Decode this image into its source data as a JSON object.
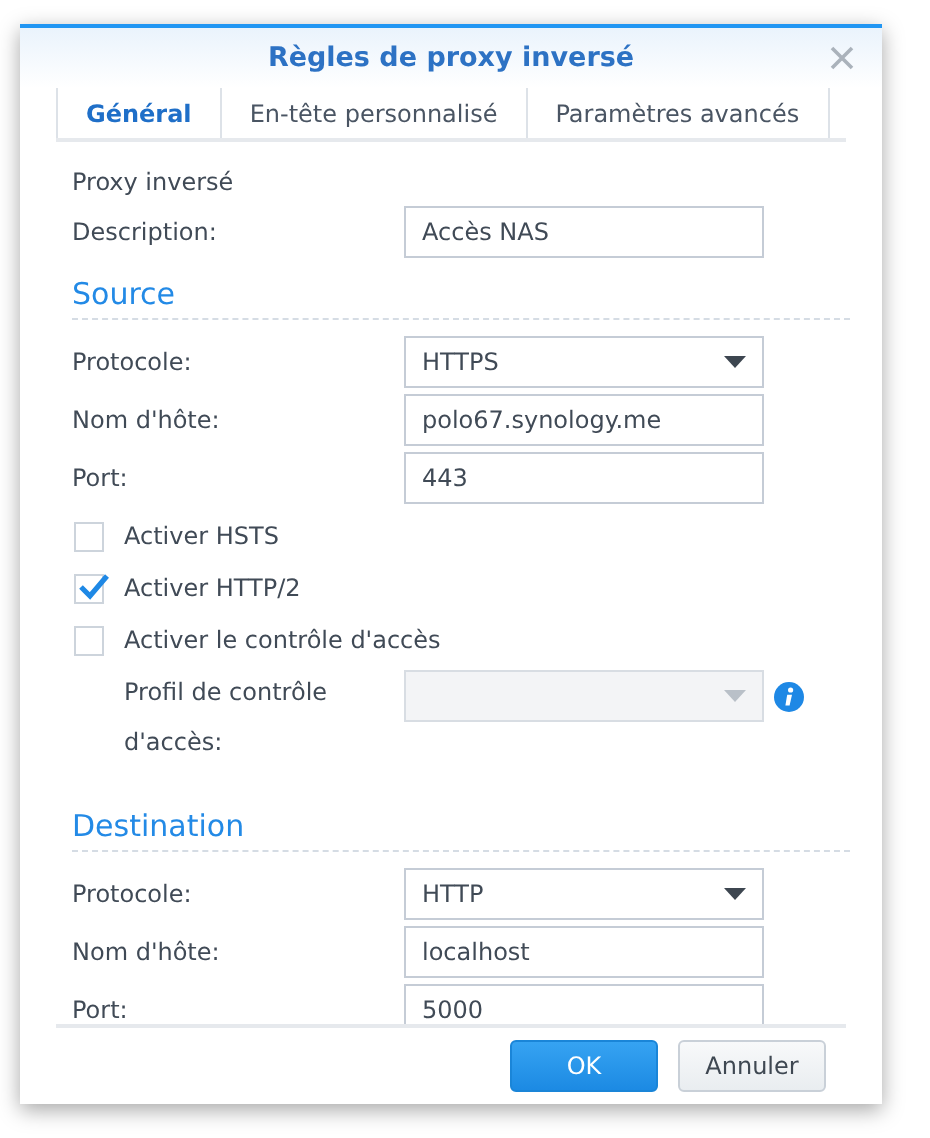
{
  "window": {
    "title": "Règles de proxy inversé"
  },
  "tabs": [
    {
      "label": "Général",
      "selected": true
    },
    {
      "label": "En-tête personnalisé",
      "selected": false
    },
    {
      "label": "Paramètres avancés",
      "selected": false
    }
  ],
  "form": [
    {
      "kind": "subtitle",
      "text": "Proxy inversé"
    },
    {
      "kind": "text",
      "label": "Description:",
      "value": "Accès NAS"
    },
    {
      "kind": "heading",
      "text": "Source"
    },
    {
      "kind": "select",
      "label": "Protocole:",
      "value": "HTTPS",
      "disabled": false
    },
    {
      "kind": "text",
      "label": "Nom d'hôte:",
      "value": "polo67.synology.me"
    },
    {
      "kind": "text",
      "label": "Port:",
      "value": "443"
    },
    {
      "kind": "checkbox",
      "label": "Activer HSTS",
      "checked": false
    },
    {
      "kind": "checkbox",
      "label": "Activer HTTP/2",
      "checked": true
    },
    {
      "kind": "checkbox",
      "label": "Activer le contrôle d'accès",
      "checked": false
    },
    {
      "kind": "profile",
      "label": "Profil de contrôle d'accès:",
      "disabled": true
    },
    {
      "kind": "heading",
      "text": "Destination"
    },
    {
      "kind": "select",
      "label": "Protocole:",
      "value": "HTTP",
      "disabled": false
    },
    {
      "kind": "text",
      "label": "Nom d'hôte:",
      "value": "localhost"
    },
    {
      "kind": "text",
      "label": "Port:",
      "value": "5000"
    }
  ],
  "buttons": [
    {
      "label": "OK",
      "kind": "primary"
    },
    {
      "label": "Annuler",
      "kind": "secondary"
    }
  ]
}
